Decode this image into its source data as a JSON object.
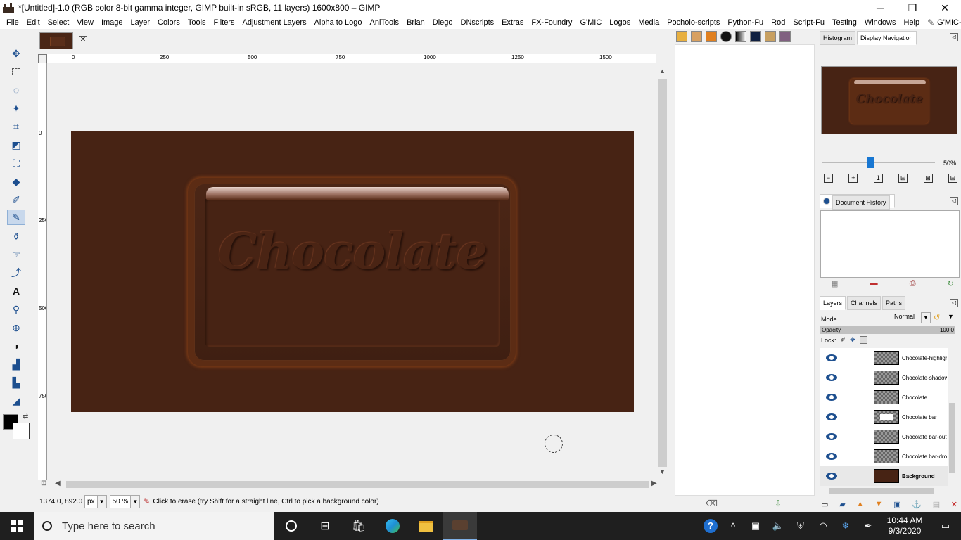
{
  "window": {
    "title": "*[Untitled]-1.0 (RGB color 8-bit gamma integer, GIMP built-in sRGB, 11 layers) 1600x800 – GIMP",
    "minimize": "─",
    "maximize": "❐",
    "close": "✕"
  },
  "menu": [
    "File",
    "Edit",
    "Select",
    "View",
    "Image",
    "Layer",
    "Colors",
    "Tools",
    "Filters",
    "Adjustment Layers",
    "Alpha to Logo",
    "AniTools",
    "Brian",
    "Diego",
    "DNscripts",
    "Extras",
    "FX-Foundry",
    "G'MIC",
    "Logos",
    "Media",
    "Pocholo-scripts",
    "Python-Fu",
    "Rod",
    "Script-Fu",
    "Testing",
    "Windows",
    "Help"
  ],
  "menu_extra": "G'MIC-QT...",
  "tab": {
    "close_glyph": "✕"
  },
  "ruler": {
    "h_labels": [
      "0",
      "250",
      "500",
      "750",
      "1000",
      "1250",
      "1500"
    ],
    "v_labels": [
      "0",
      "250",
      "500",
      "750"
    ]
  },
  "canvas": {
    "text": "Chocolate"
  },
  "status": {
    "coords": "1374.0, 892.0",
    "unit": "px",
    "zoom": "50 %",
    "message": "Click to erase (try Shift for a straight line, Ctrl to pick a background color)"
  },
  "dock": {
    "tabs_top": [
      "Histogram",
      "Display Navigation"
    ],
    "zoom_value": "50%",
    "history_tab": "Document History",
    "tabs_layers": [
      "Layers",
      "Channels",
      "Paths"
    ],
    "mode_label": "Mode",
    "mode_value": "Normal",
    "opacity_label": "Opacity",
    "opacity_value": "100.0",
    "lock_label": "Lock:",
    "layers": [
      {
        "name": "Chocolate-highlight",
        "thumb": "transparent"
      },
      {
        "name": "Chocolate-shadow",
        "thumb": "transparent"
      },
      {
        "name": "Chocolate",
        "thumb": "transparent"
      },
      {
        "name": "Chocolate bar",
        "thumb": "white"
      },
      {
        "name": "Chocolate bar-outline",
        "thumb": "transparent"
      },
      {
        "name": "Chocolate bar-drop-shadow",
        "thumb": "transparent"
      },
      {
        "name": "Background",
        "thumb": "background"
      }
    ]
  },
  "taskbar": {
    "search_placeholder": "Type here to search",
    "time": "10:44 AM",
    "date": "9/3/2020"
  }
}
